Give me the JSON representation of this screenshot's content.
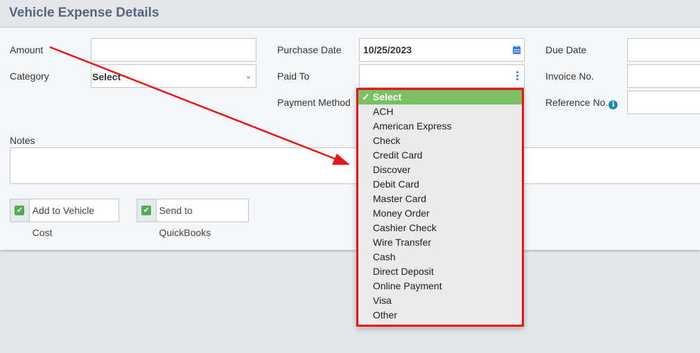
{
  "header": {
    "title": "Vehicle Expense Details"
  },
  "form": {
    "amount": {
      "label": "Amount",
      "value": ""
    },
    "category": {
      "label": "Category",
      "value": "Select"
    },
    "purchase_date": {
      "label": "Purchase Date",
      "value": "10/25/2023"
    },
    "paid_to": {
      "label": "Paid To",
      "value": ""
    },
    "payment_method": {
      "label": "Payment Method",
      "value": "Select"
    },
    "due_date": {
      "label": "Due Date",
      "value": ""
    },
    "invoice_no": {
      "label": "Invoice No.",
      "value": ""
    },
    "reference_no": {
      "label": "Reference No.",
      "info_glyph": "i",
      "value": ""
    },
    "notes": {
      "label": "Notes",
      "value": ""
    }
  },
  "checkboxes": [
    {
      "label": "Add to Vehicle Cost",
      "checked": true
    },
    {
      "label": "Send to QuickBooks",
      "checked": true
    }
  ],
  "dropdown": {
    "check_glyph": "✓",
    "selected": "Select",
    "options": [
      "Select",
      "ACH",
      "American Express",
      "Check",
      "Credit Card",
      "Discover",
      "Debit Card",
      "Master Card",
      "Money Order",
      "Cashier Check",
      "Wire Transfer",
      "Cash",
      "Direct Deposit",
      "Online Payment",
      "Visa",
      "Other"
    ]
  },
  "colors": {
    "highlight": "#e8141a",
    "selected_option": "#7bc163",
    "title": "#56647f"
  }
}
